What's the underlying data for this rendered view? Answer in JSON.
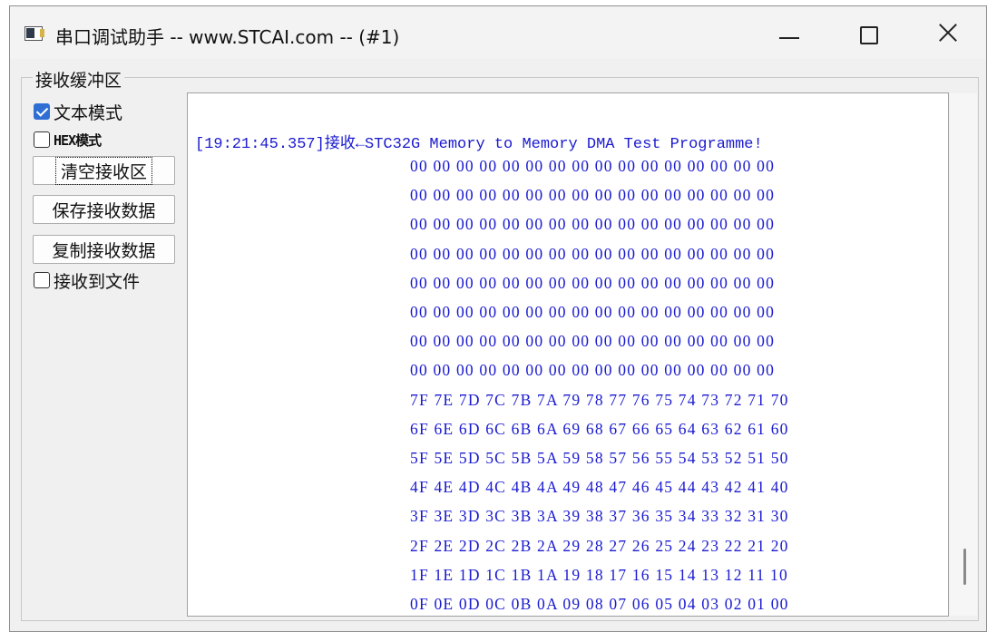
{
  "window": {
    "title": "串口调试助手 -- www.STCAI.com -- (#1)",
    "controls": [
      "minimize",
      "maximize",
      "close"
    ]
  },
  "receive_panel": {
    "group_title": "接收缓冲区",
    "text_mode": {
      "label": "文本模式",
      "checked": true
    },
    "hex_mode": {
      "label": "HEX模式",
      "checked": false
    },
    "clear_button": "清空接收区",
    "save_button": "保存接收数据",
    "copy_button": "复制接收数据",
    "to_file": {
      "label": "接收到文件",
      "checked": false
    }
  },
  "receive_log": {
    "header": "[19:21:45.357]接收←STC32G Memory to Memory DMA Test Programme!",
    "lines": [
      "00 00 00 00 00 00 00 00 00 00 00 00 00 00 00 00",
      "00 00 00 00 00 00 00 00 00 00 00 00 00 00 00 00",
      "00 00 00 00 00 00 00 00 00 00 00 00 00 00 00 00",
      "00 00 00 00 00 00 00 00 00 00 00 00 00 00 00 00",
      "00 00 00 00 00 00 00 00 00 00 00 00 00 00 00 00",
      "00 00 00 00 00 00 00 00 00 00 00 00 00 00 00 00",
      "00 00 00 00 00 00 00 00 00 00 00 00 00 00 00 00",
      "00 00 00 00 00 00 00 00 00 00 00 00 00 00 00 00",
      "7F 7E 7D 7C 7B 7A 79 78 77 76 75 74 73 72 71 70",
      "6F 6E 6D 6C 6B 6A 69 68 67 66 65 64 63 62 61 60",
      "5F 5E 5D 5C 5B 5A 59 58 57 56 55 54 53 52 51 50",
      "4F 4E 4D 4C 4B 4A 49 48 47 46 45 44 43 42 41 40",
      "3F 3E 3D 3C 3B 3A 39 38 37 36 35 34 33 32 31 30",
      "2F 2E 2D 2C 2B 2A 29 28 27 26 25 24 23 22 21 20",
      "1F 1E 1D 1C 1B 1A 19 18 17 16 15 14 13 12 11 10",
      "0F 0E 0D 0C 0B 0A 09 08 07 06 05 04 03 02 01 00"
    ],
    "text_color": "#1a1ad0"
  }
}
